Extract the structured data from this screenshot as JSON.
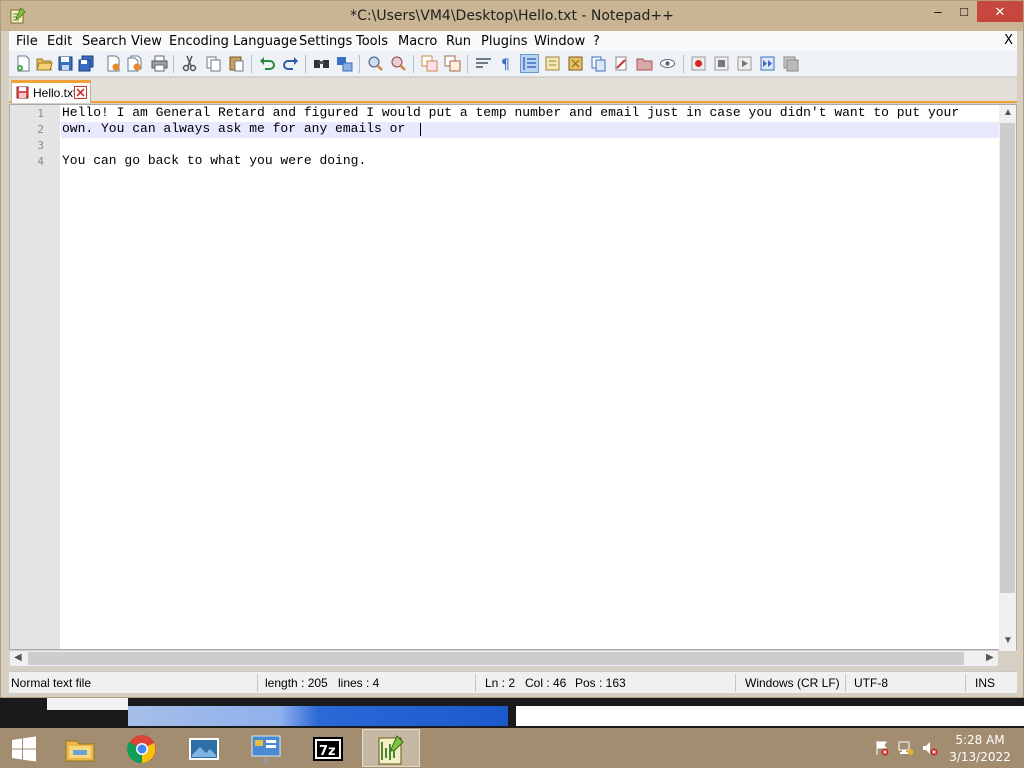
{
  "window": {
    "title": "*C:\\Users\\VM4\\Desktop\\Hello.txt - Notepad++",
    "minimize_glyph": "–",
    "maximize_glyph": "□",
    "close_glyph": "✕"
  },
  "menubar": {
    "items": [
      "File",
      "Edit",
      "Search",
      "View",
      "Encoding",
      "Language",
      "Settings",
      "Tools",
      "Macro",
      "Run",
      "Plugins",
      "Window",
      "?"
    ],
    "close_doc": "X"
  },
  "toolbar": {
    "icons": [
      "new-file-icon",
      "open-file-icon",
      "save-icon",
      "save-all-icon",
      "close-icon",
      "close-all-icon",
      "print-icon",
      "cut-icon",
      "copy-icon",
      "paste-icon",
      "undo-icon",
      "redo-icon",
      "find-icon",
      "replace-icon",
      "zoom-in-icon",
      "zoom-out-icon",
      "sync-vertical-icon",
      "sync-horizontal-icon",
      "word-wrap-icon",
      "show-all-chars-icon",
      "indent-guide-icon",
      "language-definition-icon",
      "document-map-icon",
      "function-list-icon",
      "folder-as-workspace-icon",
      "monitoring-icon",
      "record-macro-icon",
      "stop-recording-icon",
      "playback-icon",
      "run-macro-multiple-icon",
      "save-macro-icon"
    ]
  },
  "tab": {
    "label": "Hello.txt"
  },
  "editor": {
    "line_numbers": [
      "1",
      "2",
      "3",
      "4"
    ],
    "lines": [
      "Hello! I am General Retard and figured I would put a temp number and email just in case you didn't want to put your",
      "own. You can always ask me for any emails or ",
      "",
      "You can go back to what you were doing."
    ],
    "current_line": 2
  },
  "statusbar": {
    "file_type": "Normal text file",
    "length": "length : 205",
    "lines": "lines : 4",
    "ln": "Ln : 2",
    "col": "Col : 46",
    "pos": "Pos : 163",
    "eol": "Windows (CR LF)",
    "encoding": "UTF-8",
    "mode": "INS"
  },
  "taskbar": {
    "apps": [
      "file-explorer-icon",
      "chrome-icon",
      "photos-icon",
      "control-panel-icon",
      "7zip-icon",
      "notepad-plus-plus-icon"
    ],
    "sevenzip_label": "7z",
    "tray": [
      "action-center-flag-icon",
      "network-icon",
      "volume-muted-icon"
    ],
    "time": "5:28 AM",
    "date": "3/13/2022"
  },
  "colors": {
    "titlebar": "#c9b493",
    "taskbar": "#a38d70",
    "tab_accent": "#f2a13a",
    "current_line": "#e8e8ff"
  }
}
